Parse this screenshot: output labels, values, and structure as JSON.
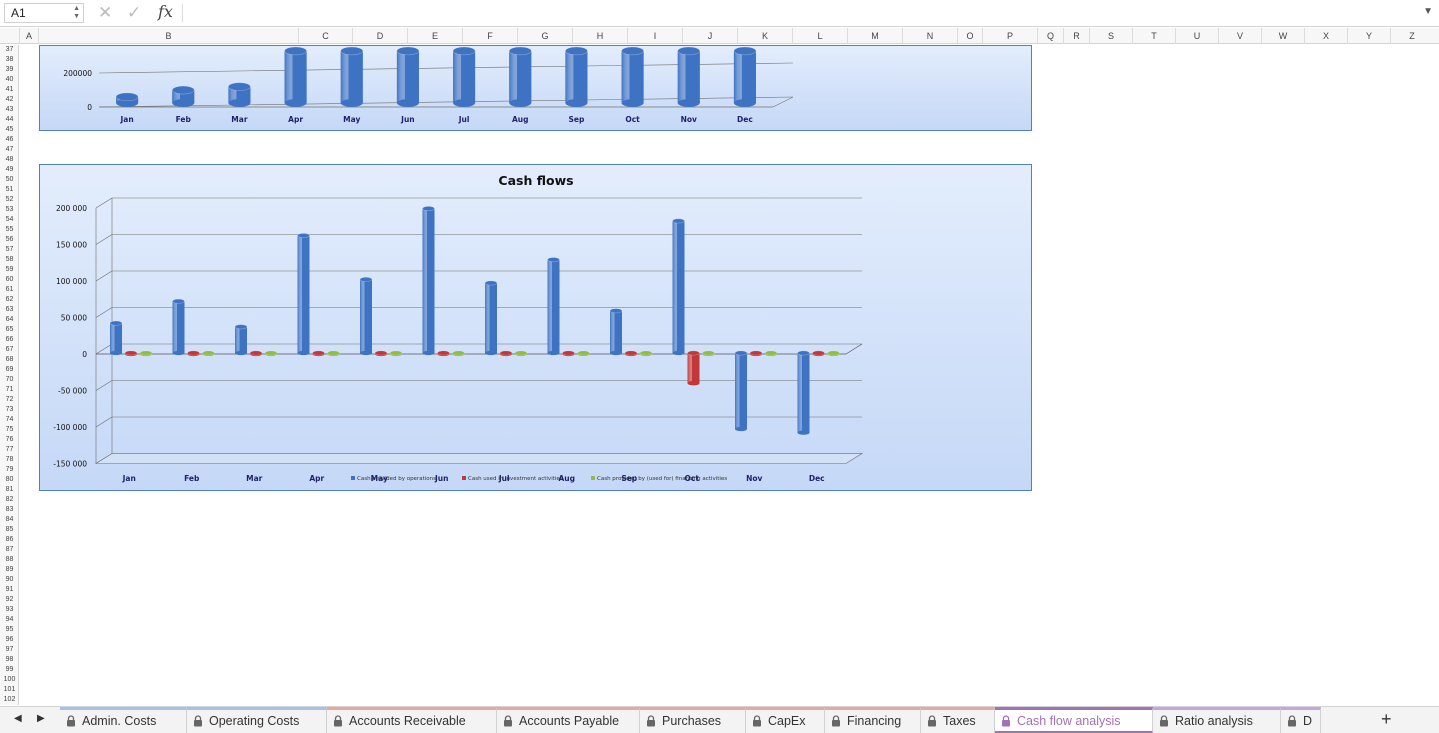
{
  "formula_bar": {
    "name_box": "A1",
    "cancel_icon": "✕",
    "enter_icon": "✓",
    "fx_label": "fx",
    "formula": ""
  },
  "columns": [
    {
      "label": "A",
      "l": 19,
      "w": 19
    },
    {
      "label": "B",
      "l": 38,
      "w": 260
    },
    {
      "label": "C",
      "l": 298,
      "w": 54
    },
    {
      "label": "D",
      "l": 352,
      "w": 55
    },
    {
      "label": "E",
      "l": 407,
      "w": 55
    },
    {
      "label": "F",
      "l": 462,
      "w": 55
    },
    {
      "label": "G",
      "l": 517,
      "w": 55
    },
    {
      "label": "H",
      "l": 572,
      "w": 55
    },
    {
      "label": "I",
      "l": 627,
      "w": 55
    },
    {
      "label": "J",
      "l": 682,
      "w": 55
    },
    {
      "label": "K",
      "l": 737,
      "w": 55
    },
    {
      "label": "L",
      "l": 792,
      "w": 55
    },
    {
      "label": "M",
      "l": 847,
      "w": 55
    },
    {
      "label": "N",
      "l": 902,
      "w": 55
    },
    {
      "label": "O",
      "l": 957,
      "w": 25
    },
    {
      "label": "P",
      "l": 982,
      "w": 55
    },
    {
      "label": "Q",
      "l": 1037,
      "w": 26
    },
    {
      "label": "R",
      "l": 1063,
      "w": 26
    },
    {
      "label": "S",
      "l": 1089,
      "w": 43
    },
    {
      "label": "T",
      "l": 1132,
      "w": 43
    },
    {
      "label": "U",
      "l": 1175,
      "w": 43
    },
    {
      "label": "V",
      "l": 1218,
      "w": 43
    },
    {
      "label": "W",
      "l": 1261,
      "w": 43
    },
    {
      "label": "X",
      "l": 1304,
      "w": 43
    },
    {
      "label": "Y",
      "l": 1347,
      "w": 43
    },
    {
      "label": "Z",
      "l": 1390,
      "w": 43
    }
  ],
  "rows": {
    "first": 37,
    "last": 102
  },
  "top_chart": {
    "ytick_labels": [
      "200000",
      "0"
    ],
    "months": [
      "Jan",
      "Feb",
      "Mar",
      "Apr",
      "May",
      "Jun",
      "Jul",
      "Aug",
      "Sep",
      "Oct",
      "Nov",
      "Dec"
    ],
    "values": [
      60000,
      100000,
      120000,
      330000,
      330000,
      330000,
      330000,
      330000,
      330000,
      330000,
      330000,
      330000
    ],
    "ylim": [
      0,
      260000
    ]
  },
  "chart_data": {
    "type": "bar",
    "title": "Cash flows",
    "categories": [
      "Jan",
      "Feb",
      "Mar",
      "Apr",
      "May",
      "Jun",
      "Jul",
      "Aug",
      "Sep",
      "Oct",
      "Nov",
      "Dec"
    ],
    "series": [
      {
        "name": "Cash provided by operations",
        "color": "#3e73c4",
        "values": [
          45000,
          75000,
          40000,
          165000,
          105000,
          202000,
          100000,
          132000,
          62000,
          185000,
          -100000,
          -105000
        ]
      },
      {
        "name": "Cash used in investment activities",
        "color": "#c0383a",
        "values": [
          0,
          0,
          0,
          0,
          0,
          0,
          0,
          0,
          0,
          -40000,
          0,
          0
        ]
      },
      {
        "name": "Cash provided by (used for) financing activities",
        "color": "#8fbc45",
        "values": [
          0,
          0,
          0,
          0,
          0,
          0,
          0,
          0,
          0,
          0,
          0,
          0
        ]
      }
    ],
    "ylim": [
      -150000,
      200000
    ],
    "ytick_labels": [
      "200 000",
      "150 000",
      "100 000",
      "50 000",
      "0",
      "-50 000",
      "-100 000",
      "-150 000"
    ],
    "ytick_values": [
      200000,
      150000,
      100000,
      50000,
      0,
      -50000,
      -100000,
      -150000
    ],
    "grid": true,
    "legend": "bottom"
  },
  "sheet_tabs": [
    {
      "label": "Admin. Costs",
      "accent": "#a6c1e8",
      "active": false
    },
    {
      "label": "Operating Costs",
      "accent": "#a6c1e8",
      "active": false
    },
    {
      "label": "Accounts Receivable",
      "accent": "#e8a6a6",
      "active": false
    },
    {
      "label": "Accounts Payable",
      "accent": "#e8a6a6",
      "active": false
    },
    {
      "label": "Purchases",
      "accent": "#e8a6a6",
      "active": false
    },
    {
      "label": "CapEx",
      "accent": "#e8a6a6",
      "active": false
    },
    {
      "label": "Financing",
      "accent": "#e8a6a6",
      "active": false
    },
    {
      "label": "Taxes",
      "accent": "#e8a6a6",
      "active": false
    },
    {
      "label": "Cash flow analysis",
      "accent": "#a271b8",
      "active": true
    },
    {
      "label": "Ratio analysis",
      "accent": "#c4a6e0",
      "active": false
    },
    {
      "label": "D",
      "accent": "#c4a6e0",
      "active": false
    }
  ],
  "add_sheet_label": "+"
}
